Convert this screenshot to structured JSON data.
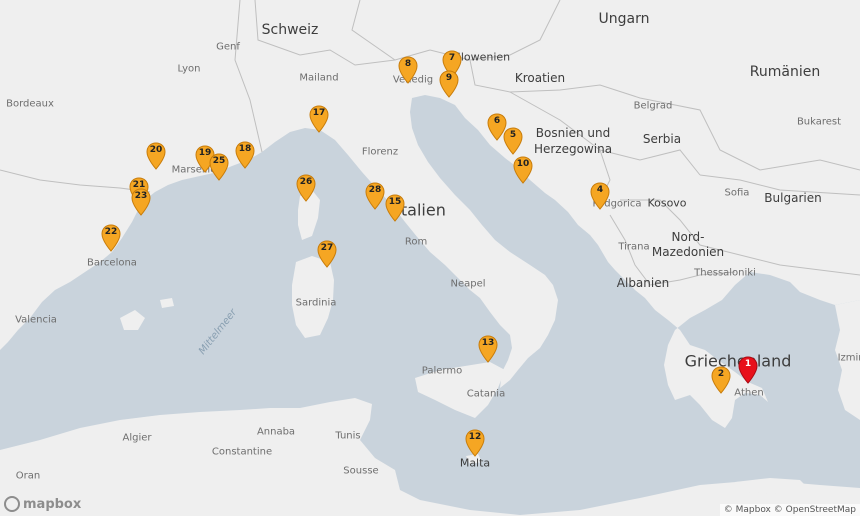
{
  "map": {
    "attribution": "© Mapbox © OpenStreetMap",
    "logo_text": "mapbox",
    "colors": {
      "water": "#c9d3dc",
      "land": "#efefef",
      "border": "#bfbfbf",
      "marker": "#f5a623",
      "marker_active": "#e8101b"
    },
    "country_labels": [
      {
        "key": "schweiz",
        "text": "Schweiz"
      },
      {
        "key": "ungarn",
        "text": "Ungarn"
      },
      {
        "key": "rumaenien",
        "text": "Rumänien"
      },
      {
        "key": "slowenien",
        "text": "Slowenien"
      },
      {
        "key": "kroatien",
        "text": "Kroatien"
      },
      {
        "key": "bosnien",
        "text": "Bosnien und Herzegowina"
      },
      {
        "key": "serbia",
        "text": "Serbia"
      },
      {
        "key": "bulgarien",
        "text": "Bulgarien"
      },
      {
        "key": "kosovo",
        "text": "Kosovo"
      },
      {
        "key": "nordmazedonien",
        "text": "Nord-Mazedonien"
      },
      {
        "key": "albanien",
        "text": "Albanien"
      },
      {
        "key": "italien",
        "text": "Italien"
      },
      {
        "key": "griechenland",
        "text": "Griechenland"
      },
      {
        "key": "malta",
        "text": "Malta"
      }
    ],
    "city_labels": [
      {
        "key": "genf",
        "text": "Genf"
      },
      {
        "key": "lyon",
        "text": "Lyon"
      },
      {
        "key": "mailand",
        "text": "Mailand"
      },
      {
        "key": "venedig",
        "text": "Venedig"
      },
      {
        "key": "bordeaux",
        "text": "Bordeaux"
      },
      {
        "key": "marseille",
        "text": "Marseille"
      },
      {
        "key": "florenz",
        "text": "Florenz"
      },
      {
        "key": "rom",
        "text": "Rom"
      },
      {
        "key": "neapel",
        "text": "Neapel"
      },
      {
        "key": "barcelona",
        "text": "Barcelona"
      },
      {
        "key": "valencia",
        "text": "Valencia"
      },
      {
        "key": "sardinia",
        "text": "Sardinia"
      },
      {
        "key": "palermo",
        "text": "Palermo"
      },
      {
        "key": "catania",
        "text": "Catania"
      },
      {
        "key": "belgrad",
        "text": "Belgrad"
      },
      {
        "key": "bukarest",
        "text": "Bukarest"
      },
      {
        "key": "sofia",
        "text": "Sofia"
      },
      {
        "key": "podgorica",
        "text": "Podgorica"
      },
      {
        "key": "tirana",
        "text": "Tirana"
      },
      {
        "key": "thessaloniki",
        "text": "Thessaloniki"
      },
      {
        "key": "athen",
        "text": "Athen"
      },
      {
        "key": "izmir",
        "text": "Izmir"
      },
      {
        "key": "algier",
        "text": "Algier"
      },
      {
        "key": "annaba",
        "text": "Annaba"
      },
      {
        "key": "tunis",
        "text": "Tunis"
      },
      {
        "key": "constantine",
        "text": "Constantine"
      },
      {
        "key": "sousse",
        "text": "Sousse"
      },
      {
        "key": "oran",
        "text": "Oran"
      }
    ],
    "sea_labels": [
      {
        "key": "mittelmeer",
        "text": "Mittelmeer"
      }
    ],
    "markers": [
      {
        "id": "1",
        "label": "1",
        "active": true
      },
      {
        "id": "2",
        "label": "2"
      },
      {
        "id": "4",
        "label": "4"
      },
      {
        "id": "5",
        "label": "5"
      },
      {
        "id": "6",
        "label": "6"
      },
      {
        "id": "7",
        "label": "7"
      },
      {
        "id": "8",
        "label": "8"
      },
      {
        "id": "9",
        "label": "9"
      },
      {
        "id": "10",
        "label": "10"
      },
      {
        "id": "12",
        "label": "12"
      },
      {
        "id": "13",
        "label": "13"
      },
      {
        "id": "15",
        "label": "15"
      },
      {
        "id": "17",
        "label": "17"
      },
      {
        "id": "18",
        "label": "18"
      },
      {
        "id": "19",
        "label": "19"
      },
      {
        "id": "20",
        "label": "20"
      },
      {
        "id": "21",
        "label": "21"
      },
      {
        "id": "22",
        "label": "22"
      },
      {
        "id": "23",
        "label": "23"
      },
      {
        "id": "25",
        "label": "25"
      },
      {
        "id": "26",
        "label": "26"
      },
      {
        "id": "27",
        "label": "27"
      },
      {
        "id": "28",
        "label": "28"
      }
    ]
  }
}
